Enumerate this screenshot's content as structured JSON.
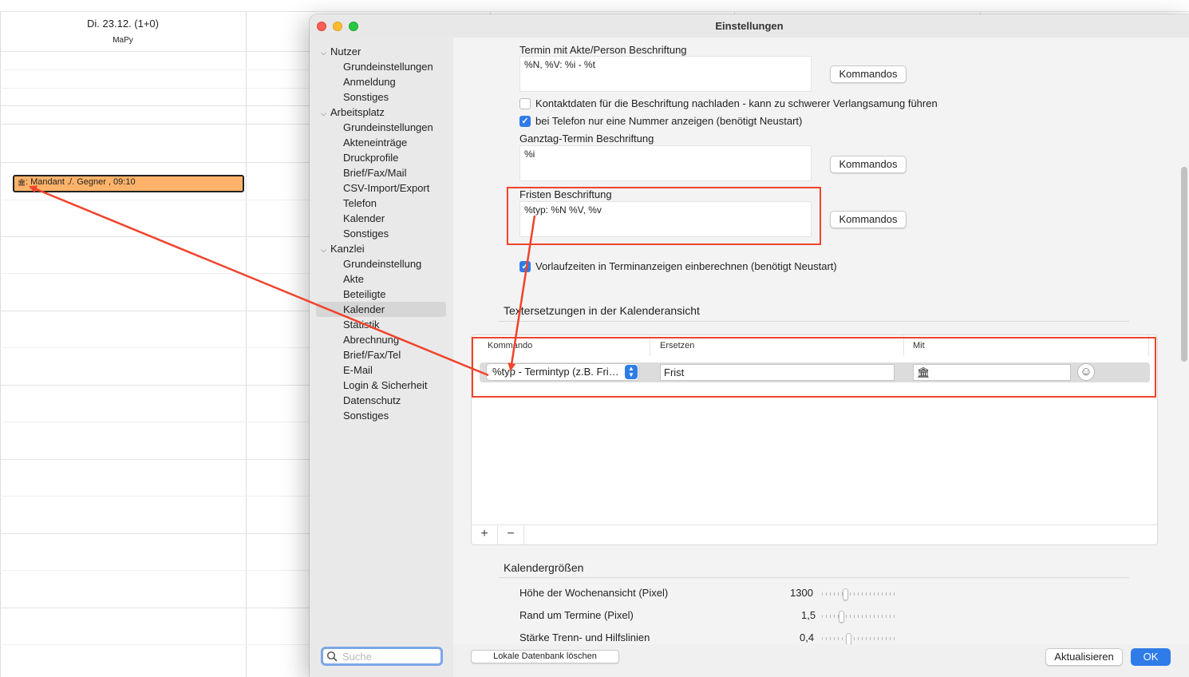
{
  "calendar": {
    "day_title": "Di. 23.12. (1+0)",
    "day_user": "MaPy",
    "event_text": ": Mandant ./. Gegner , 09:10",
    "event_icon": "bank-icon",
    "event_color": "#ffb36a"
  },
  "window": {
    "title": "Einstellungen"
  },
  "sidebar": {
    "groups": [
      {
        "label": "Nutzer",
        "items": [
          "Grundeinstellungen",
          "Anmeldung",
          "Sonstiges"
        ]
      },
      {
        "label": "Arbeitsplatz",
        "items": [
          "Grundeinstellungen",
          "Akteneinträge",
          "Druckprofile",
          "Brief/Fax/Mail",
          "CSV-Import/Export",
          "Telefon",
          "Kalender",
          "Sonstiges"
        ]
      },
      {
        "label": "Kanzlei",
        "items": [
          "Grundeinstellung",
          "Akte",
          "Beteiligte",
          "Kalender",
          "Statistik",
          "Abrechnung",
          "Brief/Fax/Tel",
          "E-Mail",
          "Login & Sicherheit",
          "Datenschutz",
          "Sonstiges"
        ]
      }
    ],
    "selected": "Kanzlei / Kalender",
    "search_placeholder": "Suche"
  },
  "content": {
    "termin_label": "Termin mit Akte/Person Beschriftung",
    "termin_value": "%N, %V: %i - %t",
    "kommandos_label": "Kommandos",
    "check_kontakt_label": "Kontaktdaten für die Beschriftung nachladen - kann zu schwerer Verlangsamung führen",
    "check_kontakt_checked": false,
    "check_telefon_label": "bei Telefon nur eine Nummer anzeigen (benötigt Neustart)",
    "check_telefon_checked": true,
    "ganztag_label": "Ganztag-Termin Beschriftung",
    "ganztag_value": "%i",
    "fristen_label": "Fristen Beschriftung",
    "fristen_value": "%typ: %N %V, %v",
    "check_vorlauf_label": "Vorlaufzeiten in Terminanzeigen einberechnen (benötigt Neustart)",
    "check_vorlauf_checked": true,
    "textersetzungen_title": "Textersetzungen in der Kalenderansicht",
    "table": {
      "headers": [
        "Kommando",
        "Ersetzen",
        "Mit"
      ],
      "row": {
        "kommando": "%typ - Termintyp (z.B. Fri…",
        "ersetzen": "Frist",
        "mit_icon": "bank-icon"
      },
      "add_label": "+",
      "remove_label": "−"
    },
    "kalendergroessen_title": "Kalendergrößen",
    "sizes": [
      {
        "label": "Höhe der Wochenansicht (Pixel)",
        "value": "1300",
        "level": 0.3
      },
      {
        "label": "Rand um Termine (Pixel)",
        "value": "1,5",
        "level": 0.25
      },
      {
        "label": "Stärke Trenn- und Hilfslinien",
        "value": "0,4",
        "level": 0.35
      }
    ]
  },
  "footer": {
    "delete_db_label": "Lokale Datenbank löschen",
    "refresh_label": "Aktualisieren",
    "ok_label": "OK"
  },
  "colors": {
    "accent": "#2f7ce8",
    "annotation": "#f0432c"
  }
}
